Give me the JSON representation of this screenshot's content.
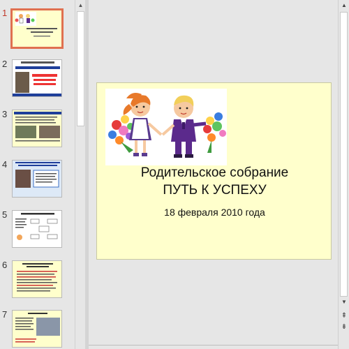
{
  "slides": [
    {
      "number": "1"
    },
    {
      "number": "2"
    },
    {
      "number": "3"
    },
    {
      "number": "4"
    },
    {
      "number": "5"
    },
    {
      "number": "6"
    },
    {
      "number": "7"
    }
  ],
  "current_slide": {
    "title_line1": "Родительское собрание",
    "title_line2": "ПУТЬ К УСПЕХУ",
    "date": "18 февраля 2010 года",
    "background_color": "#ffffcc"
  },
  "icons": {
    "scroll_up": "triangle-up-icon",
    "scroll_down": "triangle-down-icon",
    "prev_slide": "double-chevron-up-icon",
    "next_slide": "double-chevron-down-icon"
  },
  "colors": {
    "active_thumbnail_border": "#e07050",
    "active_slide_number": "#c0392b"
  }
}
